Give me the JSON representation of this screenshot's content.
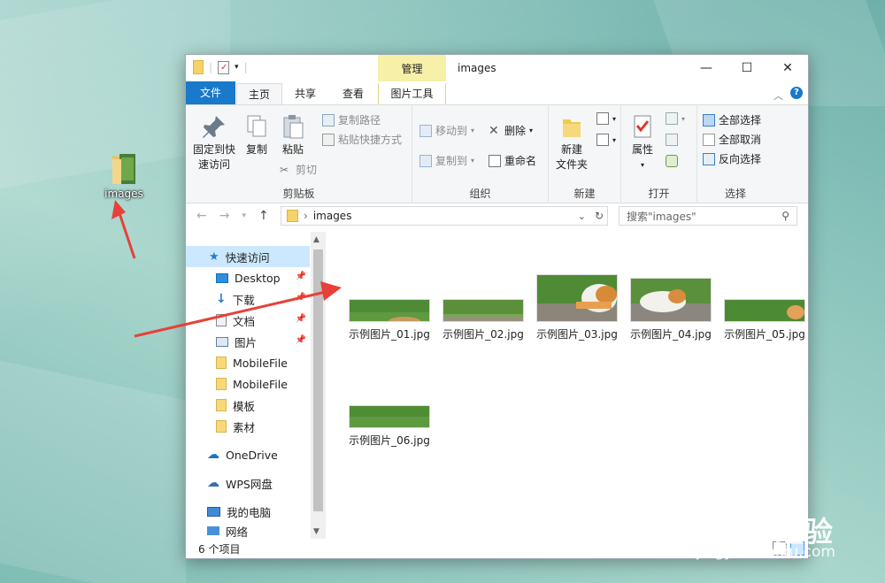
{
  "desktop": {
    "icon_label": "images"
  },
  "window": {
    "title": "images",
    "context_tab_group": "管理",
    "controls": {
      "minimize": "—",
      "maximize": "☐",
      "close": "✕"
    }
  },
  "tabs": {
    "file": "文件",
    "home": "主页",
    "share": "共享",
    "view": "查看",
    "picture_tools": "图片工具"
  },
  "ribbon": {
    "clipboard": {
      "label": "剪贴板",
      "pin_quick_access": "固定到快\n速访问",
      "copy": "复制",
      "paste": "粘贴",
      "copy_path": "复制路径",
      "paste_shortcut": "粘贴快捷方式",
      "cut": "剪切"
    },
    "organize": {
      "label": "组织",
      "move_to": "移动到",
      "copy_to": "复制到",
      "delete": "删除",
      "rename": "重命名"
    },
    "new": {
      "label": "新建",
      "new_folder": "新建\n文件夹"
    },
    "open": {
      "label": "打开",
      "properties": "属性"
    },
    "select": {
      "label": "选择",
      "select_all": "全部选择",
      "select_none": "全部取消",
      "invert": "反向选择"
    }
  },
  "address": {
    "path": "images",
    "search_placeholder": "搜索\"images\""
  },
  "nav": {
    "quick_access": "快速访问",
    "items": [
      "Desktop",
      "下载",
      "文档",
      "图片",
      "MobileFile",
      "MobileFile",
      "模板",
      "素材"
    ],
    "onedrive": "OneDrive",
    "wps": "WPS网盘",
    "this_pc": "我的电脑",
    "network": "网络"
  },
  "files": [
    {
      "name": "示例图片_01.jpg"
    },
    {
      "name": "示例图片_02.jpg"
    },
    {
      "name": "示例图片_03.jpg"
    },
    {
      "name": "示例图片_04.jpg"
    },
    {
      "name": "示例图片_05.jpg"
    },
    {
      "name": "示例图片_06.jpg"
    }
  ],
  "status": {
    "item_count": "6 个项目"
  },
  "watermark": {
    "brand": "Baidu经验",
    "url": "jingyan.baidu.com"
  },
  "colors": {
    "accent": "#1979ca",
    "selection": "#cce8ff",
    "manage_tab": "#f6f0a8",
    "annotation_arrow": "#e8403a"
  }
}
